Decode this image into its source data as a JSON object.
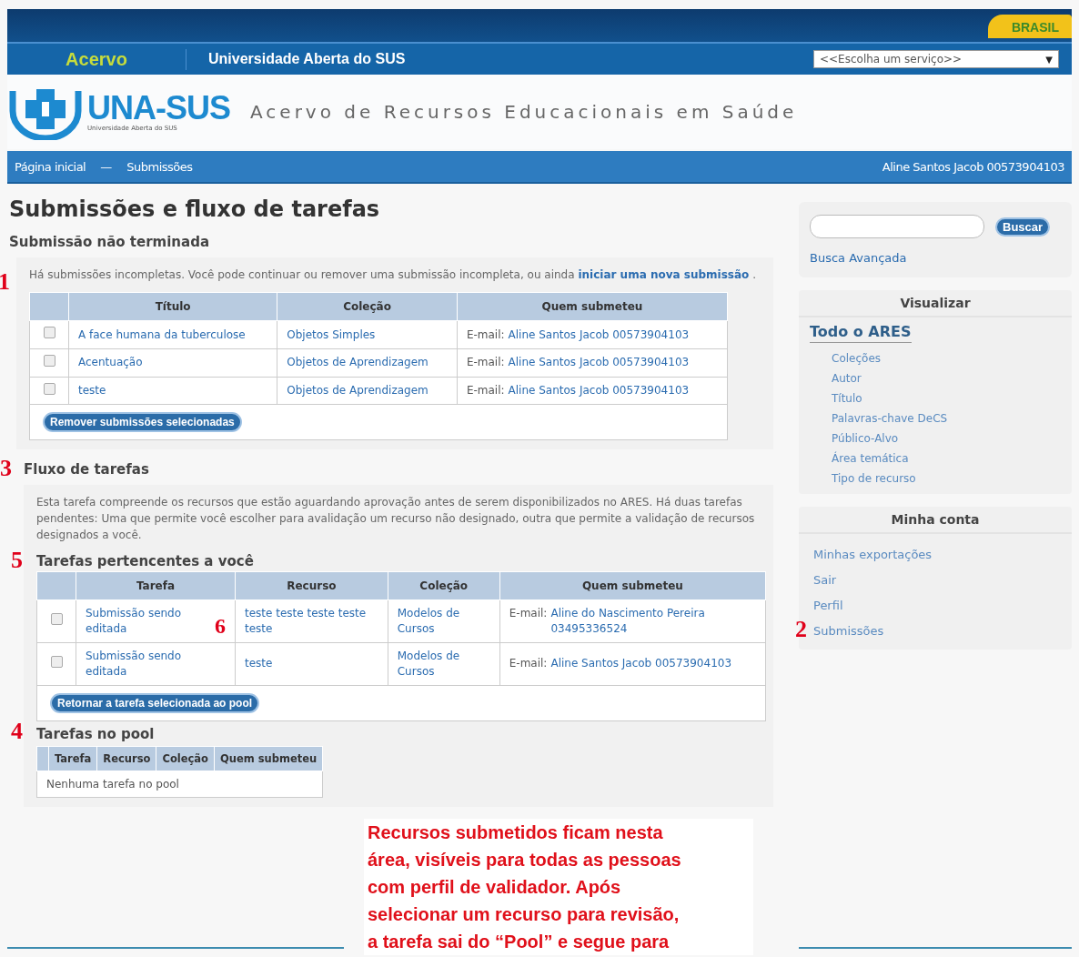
{
  "top_bar": {
    "badge": "BRASIL"
  },
  "nav": {
    "brand": "Acervo",
    "site": "Universidade Aberta do SUS",
    "service_select": {
      "value": "<<Escolha um serviço>>",
      "caret": "▼"
    }
  },
  "header": {
    "logo_text": "UNA-SUS",
    "logo_subtitle": "Universidade Aberta do SUS",
    "tagline": "Acervo de Recursos Educacionais em Saúde"
  },
  "breadcrumbs": {
    "items": [
      "Página inicial",
      "Submissões"
    ],
    "separator": "—",
    "user": "Aline Santos Jacob 00573904103"
  },
  "page_title": "Submissões e fluxo de tarefas",
  "unfinished": {
    "heading": "Submissão não terminada",
    "marker": "1",
    "intro": "Há submissões incompletas. Você pode continuar ou remover uma submissão incompleta, ou ainda",
    "intro_link": "iniciar uma nova submissão",
    "intro_end": ".",
    "columns": [
      "Título",
      "Coleção",
      "Quem submeteu"
    ],
    "rows": [
      {
        "checked": false,
        "cells": [
          "A face humana da tuberculose",
          "Objetos Simples"
        ],
        "email_label": "E-mail:",
        "submitter": "Aline Santos Jacob 00573904103"
      },
      {
        "checked": false,
        "cells": [
          "Acentuação",
          "Objetos de Aprendizagem"
        ],
        "email_label": "E-mail:",
        "submitter": "Aline Santos Jacob 00573904103"
      },
      {
        "checked": false,
        "cells": [
          "teste",
          "Objetos de Aprendizagem"
        ],
        "email_label": "E-mail:",
        "submitter": "Aline Santos Jacob 00573904103"
      }
    ],
    "button": "Remover submissões selecionadas"
  },
  "workflow": {
    "heading": "Fluxo de tarefas",
    "marker": "3",
    "description": "Esta tarefa compreende os recursos que estão aguardando aprovação antes de serem disponibilizados no ARES. Há duas tarefas pendentes: Uma que permite você escolher para avalidação um recurso não designado, outra que permite a validação de recursos designados a você.",
    "mine": {
      "heading": "Tarefas pertencentes a você",
      "marker": "5",
      "columns": [
        "Tarefa",
        "Recurso",
        "Coleção",
        "Quem submeteu"
      ],
      "rows": [
        {
          "checked": false,
          "cells": [
            "Submissão sendo editada",
            "teste teste teste teste teste",
            "Modelos de Cursos"
          ],
          "email_label": "E-mail:",
          "submitter": "Aline do Nascimento Pereira 03495336524",
          "marker": "6"
        },
        {
          "checked": false,
          "cells": [
            "Submissão sendo editada",
            "teste",
            "Modelos de Cursos"
          ],
          "email_label": "E-mail:",
          "submitter": "Aline Santos Jacob 00573904103"
        }
      ],
      "button": "Retornar a tarefa selecionada ao pool"
    },
    "pool": {
      "heading": "Tarefas no pool",
      "marker": "4",
      "columns": [
        "Tarefa",
        "Recurso",
        "Coleção",
        "Quem submeteu"
      ],
      "empty": "Nenhuma tarefa no pool"
    }
  },
  "sidebar": {
    "search": {
      "button": "Buscar",
      "advanced": "Busca Avançada"
    },
    "browse": {
      "heading": "Visualizar",
      "subheading": "Todo o ARES",
      "items": [
        "Coleções",
        "Autor",
        "Título",
        "Palavras-chave DeCS",
        "Público-Alvo",
        "Área temática",
        "Tipo de recurso"
      ]
    },
    "account": {
      "heading": "Minha conta",
      "items": [
        {
          "label": "Minhas exportações"
        },
        {
          "label": "Sair"
        },
        {
          "label": "Perfil"
        },
        {
          "label": "Submissões",
          "marker": "2"
        }
      ]
    }
  },
  "callout": {
    "lines": [
      "Recursos submetidos ficam nesta",
      "área, visíveis para todas as pessoas",
      "com perfil de validador. Após",
      "selecionar um recurso para revisão,",
      "a tarefa sai do “Pool” e segue para"
    ]
  }
}
